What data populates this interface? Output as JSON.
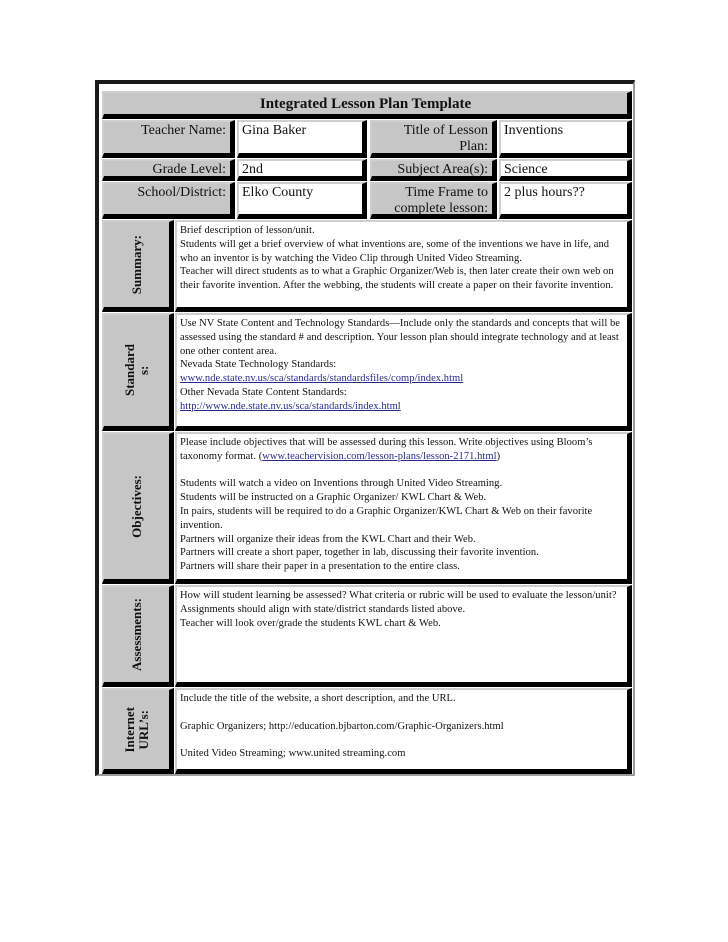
{
  "document": {
    "title": "Integrated Lesson Plan Template",
    "header_fields": {
      "teacher_name": {
        "label": "Teacher Name:",
        "value": "Gina Baker"
      },
      "lesson_title": {
        "label": "Title of Lesson Plan:",
        "value": "Inventions"
      },
      "grade_level": {
        "label": "Grade Level:",
        "value": "2nd"
      },
      "subject_area": {
        "label": "Subject Area(s):",
        "value": "Science"
      },
      "school_district": {
        "label": "School/District:",
        "value": "Elko County"
      },
      "time_frame": {
        "label": "Time Frame to complete lesson:",
        "value": "2 plus hours??"
      }
    },
    "sections": {
      "summary": {
        "label": "Summary:",
        "lines": [
          "Brief description of lesson/unit.",
          "Students will get a brief overview of what inventions are, some of the inventions we have in life, and who an inventor is by watching the Video Clip through United Video Streaming.",
          "Teacher will direct students as to what a Graphic Organizer/Web is, then later create their own web on their favorite invention.  After the webbing, the students will create a paper on their favorite invention."
        ]
      },
      "standards": {
        "label": "Standard\ns:",
        "intro": "Use NV State Content and Technology Standards—Include only the standards and concepts that will be assessed using the standard # and description.  Your lesson plan should integrate technology and at least one other content area.",
        "tech_heading": "Nevada State Technology Standards:",
        "tech_link": "www.nde.state.nv.us/sca/standards/standardsfiles/comp/index.html",
        "content_heading": "Other Nevada State Content Standards:",
        "content_link": "http://www.nde.state.nv.us/sca/standards/index.html"
      },
      "objectives": {
        "label": "Objectives:",
        "intro_before_link": "Please include objectives that will be assessed during this lesson.  Write objectives using Bloom’s taxonomy format. (",
        "intro_link": "www.teachervision.com/lesson-plans/lesson-2171.html",
        "intro_after_link": ")",
        "items": [
          "Students will watch a video on Inventions through United Video Streaming.",
          "Students will be instructed on a Graphic Organizer/ KWL Chart & Web.",
          "In pairs, students will be required to do a Graphic Organizer/KWL Chart & Web on their favorite invention.",
          "Partners will organize their ideas from the KWL Chart and their Web.",
          "Partners will create a short paper, together in lab, discussing their favorite invention.",
          "Partners will share their paper in a presentation to the entire class."
        ]
      },
      "assessments": {
        "label": "Assessments:",
        "lines": [
          "How will student learning be assessed?  What criteria or rubric will be used to evaluate the lesson/unit?  Assignments should align with state/district standards listed above.",
          "Teacher will look over/grade the students KWL chart & Web."
        ]
      },
      "internet_urls": {
        "label": "Internet\nURL’s:",
        "intro": "Include the title of the website, a short description, and the URL.",
        "entries": [
          "Graphic Organizers; http://education.bjbarton.com/Graphic-Organizers.html",
          "United Video Streaming; www.united streaming.com"
        ]
      }
    }
  },
  "colors": {
    "label_bg": "#c6c6c6",
    "value_bg": "#ffffff",
    "bevel_dark": "#000000",
    "link": "#2a2a8a"
  }
}
